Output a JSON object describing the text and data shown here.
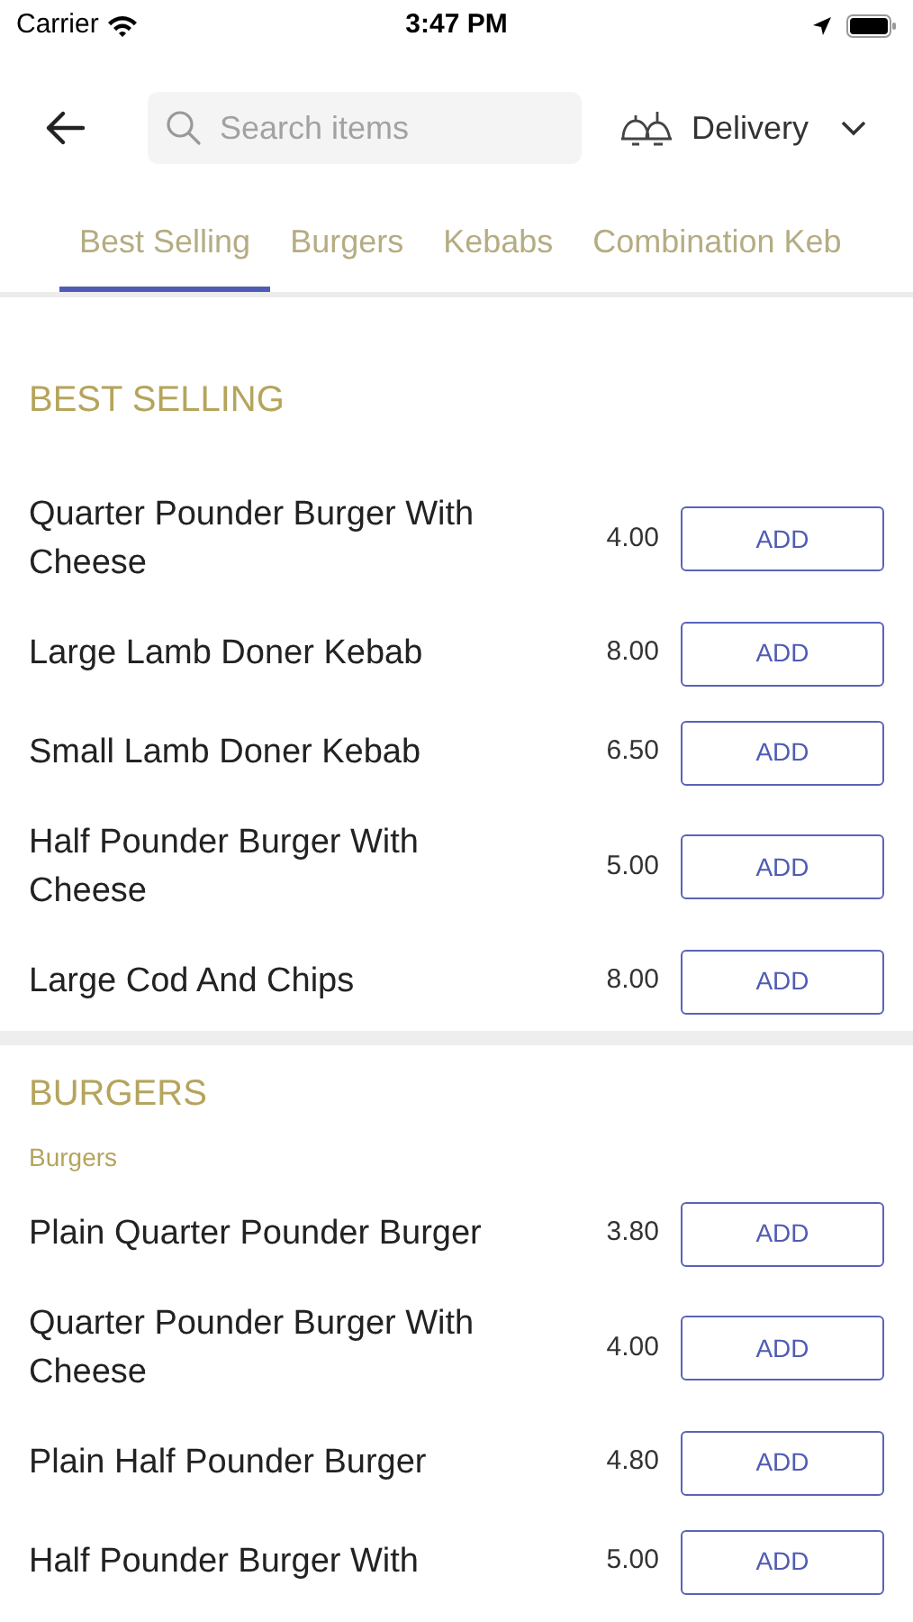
{
  "status_bar": {
    "carrier": "Carrier",
    "time": "3:47 PM"
  },
  "header": {
    "search": {
      "placeholder": "Search items"
    },
    "mode": "Delivery"
  },
  "tabs": [
    {
      "label": "Best Selling",
      "selected": true
    },
    {
      "label": "Burgers",
      "selected": false
    },
    {
      "label": "Kebabs",
      "selected": false
    },
    {
      "label": "Combination Keb",
      "selected": false
    }
  ],
  "sections": [
    {
      "title": "BEST SELLING",
      "items": [
        {
          "name": "Quarter Pounder Burger With Cheese",
          "price": "4.00",
          "button": "ADD"
        },
        {
          "name": "Large Lamb Doner Kebab",
          "price": "8.00",
          "button": "ADD"
        },
        {
          "name": "Small Lamb Doner Kebab",
          "price": "6.50",
          "button": "ADD"
        },
        {
          "name": "Half Pounder Burger With Cheese",
          "price": "5.00",
          "button": "ADD"
        },
        {
          "name": "Large Cod And Chips",
          "price": "8.00",
          "button": "ADD"
        }
      ]
    },
    {
      "title": "BURGERS",
      "subtitle": "Burgers",
      "items": [
        {
          "name": "Plain Quarter Pounder Burger",
          "price": "3.80",
          "button": "ADD"
        },
        {
          "name": "Quarter Pounder Burger With Cheese",
          "price": "4.00",
          "button": "ADD"
        },
        {
          "name": "Plain Half Pounder Burger",
          "price": "4.80",
          "button": "ADD"
        },
        {
          "name": "Half Pounder Burger With",
          "price": "5.00",
          "button": "ADD"
        }
      ]
    }
  ]
}
